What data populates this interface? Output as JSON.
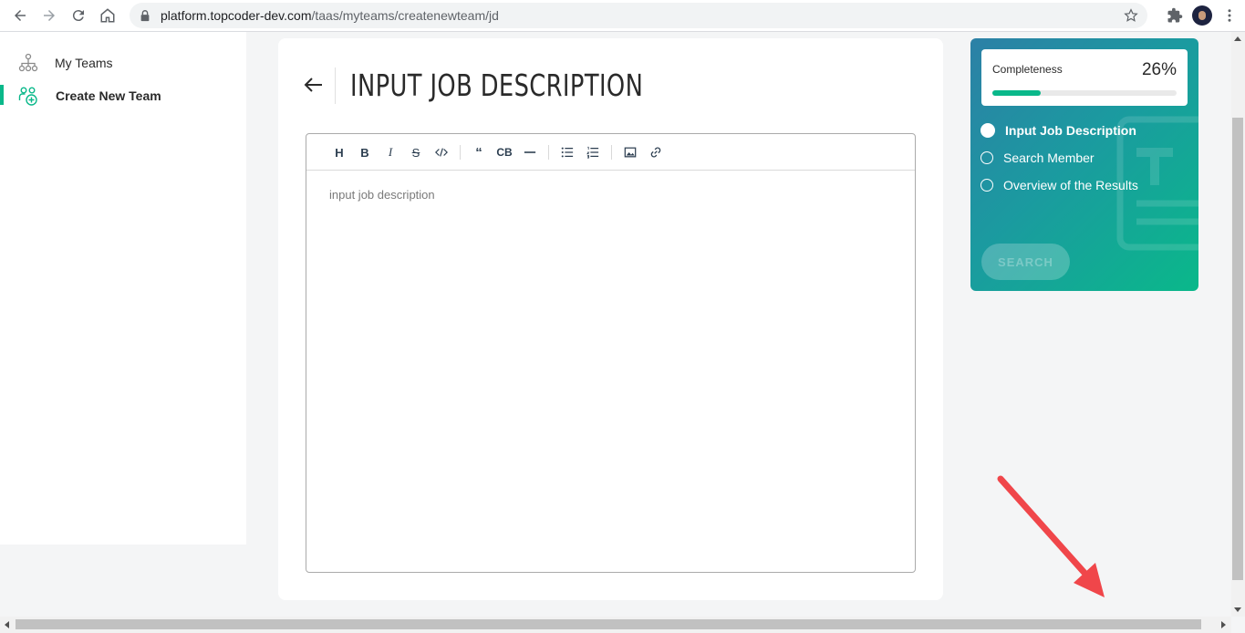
{
  "browser": {
    "url_host": "platform.topcoder-dev.com",
    "url_path": "/taas/myteams/createnewteam/jd"
  },
  "sidebar": {
    "items": [
      {
        "label": "My Teams",
        "icon": "org-chart-icon"
      },
      {
        "label": "Create New Team",
        "icon": "add-team-icon"
      }
    ]
  },
  "main": {
    "title": "INPUT JOB DESCRIPTION",
    "editor": {
      "placeholder": "input job description",
      "toolbar": [
        "heading",
        "bold",
        "italic",
        "strikethrough",
        "code",
        "quote",
        "code-block",
        "horizontal-rule",
        "bullet-list",
        "ordered-list",
        "image",
        "link"
      ]
    }
  },
  "progress": {
    "completeness_label": "Completeness",
    "completeness_value": "26%",
    "completeness_fraction": 0.26,
    "steps": [
      {
        "label": "Input Job Description",
        "active": true
      },
      {
        "label": "Search Member",
        "active": false
      },
      {
        "label": "Overview of the Results",
        "active": false
      }
    ],
    "search_button": "SEARCH"
  },
  "colors": {
    "accent": "#0ab88a",
    "card_gradient_start": "#2c80a6",
    "annotation_arrow": "#f0464a"
  }
}
